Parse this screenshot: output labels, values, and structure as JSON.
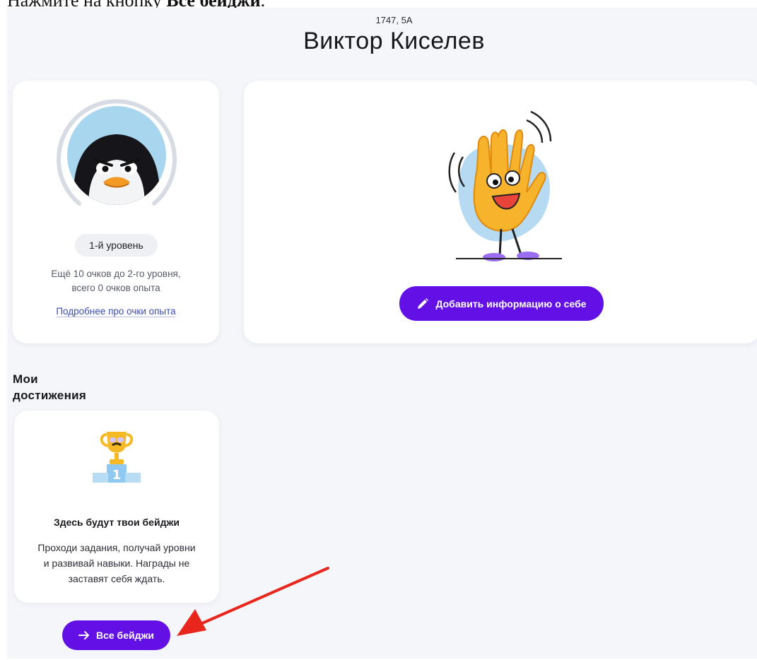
{
  "instruction": {
    "prefix": "Нажмите на кнопку ",
    "bold": "Все бейджи",
    "suffix": "."
  },
  "student": {
    "meta": "1747, 5А",
    "name": "Виктор Киселев"
  },
  "level_card": {
    "level_label": "1-й уровень",
    "progress_line1": "Ещё 10 очков до 2-го уровня,",
    "progress_line2": "всего 0 очков опыта",
    "link_label": "Подробнее про очки опыта",
    "avatar_icon": "penguin-avatar",
    "level_progress": 0
  },
  "about_card": {
    "illustration_icon": "waving-hand-character",
    "add_info_label": "Добавить информацию о себе",
    "add_info_icon": "pencil-icon"
  },
  "achievements": {
    "title_line1": "Мои",
    "title_line2": "достижения",
    "badge_icon": "trophy-podium-icon",
    "empty_title": "Здесь будут твои бейджи",
    "empty_line1": "Проходи задания, получай уровни",
    "empty_line2": "и развивай навыки. Награды не",
    "empty_line3": "заставят себя ждать.",
    "all_badges_label": "Все бейджи",
    "all_badges_icon": "arrow-right-icon"
  },
  "colors": {
    "accent": "#6210e6",
    "page_bg": "#f4f6fa",
    "annotation_arrow": "#e8261c"
  }
}
